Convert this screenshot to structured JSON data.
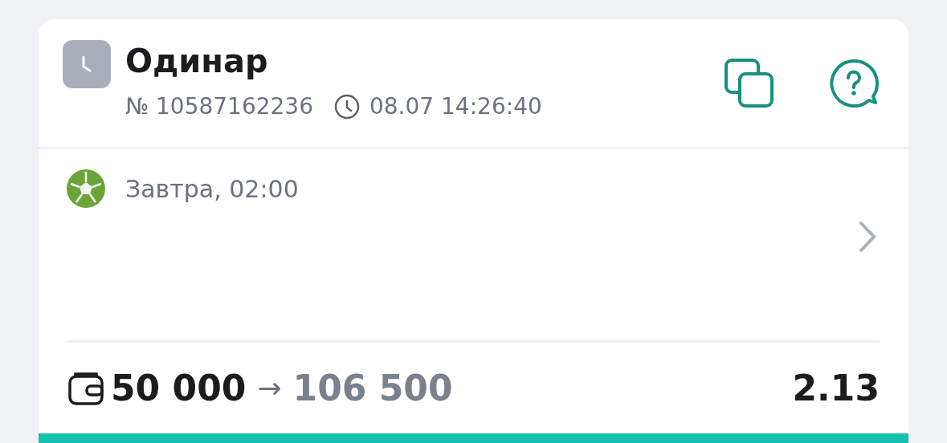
{
  "bet": {
    "title": "Одинар",
    "number": "№ 10587162236",
    "time": "08.07 14:26:40"
  },
  "event": {
    "time": "Завтра, 02:00"
  },
  "footer": {
    "stake": "50 000",
    "arrow": "→",
    "payout": "106 500",
    "odds": "2.13"
  }
}
